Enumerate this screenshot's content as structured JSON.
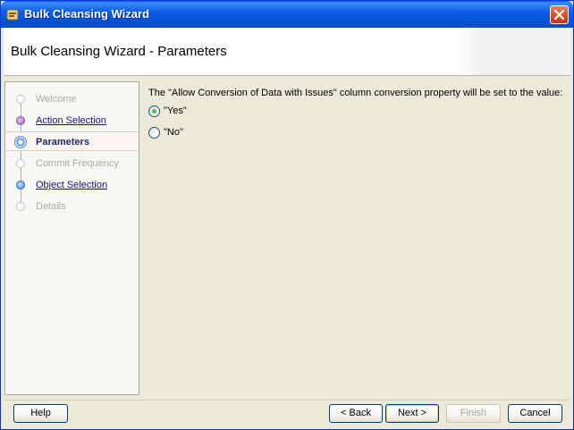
{
  "window": {
    "title": "Bulk Cleansing Wizard"
  },
  "header": {
    "title": "Bulk Cleansing Wizard - Parameters"
  },
  "nav": {
    "items": [
      {
        "label": "Welcome",
        "state": "disabled"
      },
      {
        "label": "Action Selection",
        "state": "link"
      },
      {
        "label": "Parameters",
        "state": "current"
      },
      {
        "label": "Commit Frequency",
        "state": "disabled"
      },
      {
        "label": "Object Selection",
        "state": "link"
      },
      {
        "label": "Details",
        "state": "disabled"
      }
    ]
  },
  "content": {
    "prompt": "The \"Allow Conversion of Data with Issues\" column conversion property will be set to the value:",
    "options": [
      {
        "label": "\"Yes\"",
        "checked": true
      },
      {
        "label": "\"No\"",
        "checked": false
      }
    ]
  },
  "footer": {
    "help": "Help",
    "back": "< Back",
    "next": "Next >",
    "finish": "Finish",
    "cancel": "Cancel"
  },
  "colors": {
    "titlebar": "#0453d9",
    "current_step": "#1d2a6b",
    "link": "#1a0f8a"
  }
}
